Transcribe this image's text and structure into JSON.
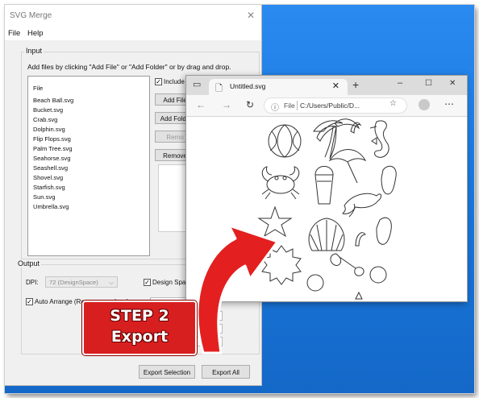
{
  "merge_window": {
    "title": "SVG Merge",
    "menu": [
      "File",
      "Help"
    ],
    "input_group_label": "Input",
    "hint": "Add files by clicking \"Add File\" or \"Add Folder\" or by drag and drop.",
    "list_header": "File",
    "files": [
      "Beach Ball.svg",
      "Bucket.svg",
      "Crab.svg",
      "Dolphin.svg",
      "Flip Flops.svg",
      "Palm Tree.svg",
      "Seahorse.svg",
      "Seashell.svg",
      "Shovel.svg",
      "Starfish.svg",
      "Sun.svg",
      "Umbrella.svg"
    ],
    "include_label": "Include s",
    "buttons": {
      "add_file": "Add File",
      "add_folder": "Add Folde",
      "remove": "Remo",
      "remove_all": "Remove"
    },
    "output_group_label": "Output",
    "dpi_label": "DPI:",
    "dpi_value": "72 (DesignSpace)",
    "design_space_label": "Design Space",
    "auto_arrange_label": "Auto Arrange (Remove overlaps)",
    "export_selection": "Export Selection",
    "export_all": "Export All"
  },
  "browser": {
    "tab_title": "Untitled.svg",
    "address_prefix": "File",
    "address": "C:/Users/Public/D...",
    "window_controls": [
      "–",
      "☐",
      "✕"
    ]
  },
  "annotation": {
    "line1": "STEP 2",
    "line2": "Export",
    "color": "#d81f1f"
  }
}
